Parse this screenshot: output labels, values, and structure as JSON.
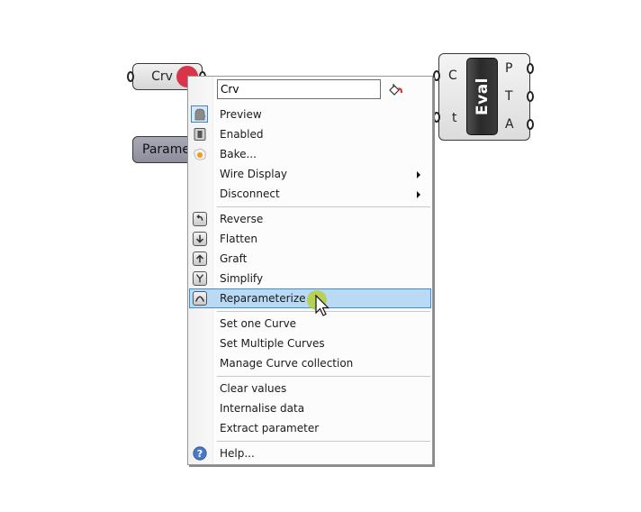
{
  "canvas": {
    "crv_param": {
      "label": "Crv"
    },
    "param_param": {
      "label": "Parame"
    },
    "eval_component": {
      "title": "Eval",
      "inputs": [
        "C",
        "t"
      ],
      "outputs": [
        "P",
        "T",
        "A"
      ]
    }
  },
  "context_menu": {
    "name_field": {
      "value": "Crv"
    },
    "groups": [
      [
        {
          "label": "Preview",
          "icon": "preview-icon",
          "checked": true
        },
        {
          "label": "Enabled",
          "icon": "enabled-icon"
        },
        {
          "label": "Bake...",
          "icon": "bake-icon"
        },
        {
          "label": "Wire Display",
          "submenu": true
        },
        {
          "label": "Disconnect",
          "submenu": true
        }
      ],
      [
        {
          "label": "Reverse",
          "icon": "reverse-icon"
        },
        {
          "label": "Flatten",
          "icon": "flatten-icon"
        },
        {
          "label": "Graft",
          "icon": "graft-icon"
        },
        {
          "label": "Simplify",
          "icon": "simplify-icon"
        },
        {
          "label": "Reparameterize",
          "icon": "reparameterize-icon",
          "highlighted": true
        }
      ],
      [
        {
          "label": "Set one Curve"
        },
        {
          "label": "Set Multiple Curves"
        },
        {
          "label": "Manage Curve collection"
        }
      ],
      [
        {
          "label": "Clear values"
        },
        {
          "label": "Internalise data"
        },
        {
          "label": "Extract parameter"
        }
      ],
      [
        {
          "label": "Help...",
          "icon": "help-icon"
        }
      ]
    ]
  },
  "colors": {
    "highlight_bg": "#b9d9f5",
    "highlight_border": "#3d8ed8",
    "param_dot": "#d8344a",
    "click_indicator": "#b5cf3a"
  }
}
